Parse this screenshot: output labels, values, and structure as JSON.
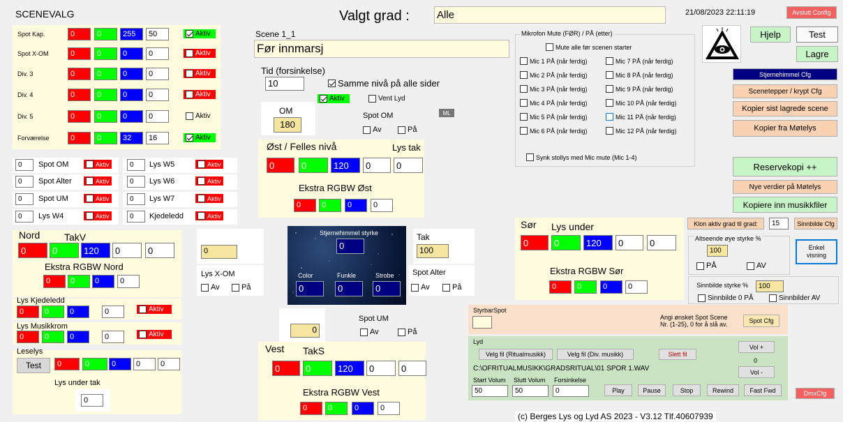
{
  "header": {
    "title": "SCENEVALG",
    "valgt_grad_label": "Valgt grad :",
    "valgt_grad_value": "Alle",
    "datetime": "21/08/2023 22:11:19",
    "exit_label": "Avslutt Config"
  },
  "rgb_rows": [
    {
      "name": "Spot Kap.",
      "r": "0",
      "g": "0",
      "b": "255",
      "w": "50",
      "active": "Aktiv",
      "on": true
    },
    {
      "name": "Spot X-OM",
      "r": "0",
      "g": "0",
      "b": "0",
      "w": "0",
      "active": "Aktiv",
      "on": false
    },
    {
      "name": "Div. 3",
      "r": "0",
      "g": "0",
      "b": "0",
      "w": "0",
      "active": "Aktiv",
      "on": false
    },
    {
      "name": "Div. 4",
      "r": "0",
      "g": "0",
      "b": "0",
      "w": "0",
      "active": "Aktiv",
      "on": false
    },
    {
      "name": "Div. 5",
      "r": "0",
      "g": "0",
      "b": "0",
      "w": "0",
      "active": "Aktiv",
      "on": false
    },
    {
      "name": "Forværelse",
      "r": "0",
      "g": "0",
      "b": "32",
      "w": "16",
      "active": "Aktiv",
      "on": true
    }
  ],
  "small_rows": {
    "left": [
      {
        "value": "0",
        "label": "Spot OM",
        "active": "Aktiv"
      },
      {
        "value": "0",
        "label": "Spot Alter",
        "active": "Aktiv"
      },
      {
        "value": "0",
        "label": "Spot UM",
        "active": "Aktiv"
      },
      {
        "value": "0",
        "label": "Lys W4",
        "active": "Aktiv"
      }
    ],
    "right": [
      {
        "value": "0",
        "label": "Lys W5",
        "active": "Aktiv"
      },
      {
        "value": "0",
        "label": "Lys W6",
        "active": "Aktiv"
      },
      {
        "value": "0",
        "label": "Lys W7",
        "active": "Aktiv"
      },
      {
        "value": "0",
        "label": "Kjedeledd",
        "active": "Aktiv"
      }
    ]
  },
  "nord": {
    "title": "Nord",
    "takv": "TakV",
    "r": "0",
    "g": "0",
    "b": "120",
    "w": "0",
    "extra": "0",
    "ekstra_title": "Ekstra RGBW Nord",
    "er": "0",
    "eg": "0",
    "eb": "0",
    "ew": "0"
  },
  "lys_kjedeledd": {
    "title": "Lys Kjedeledd",
    "r": "0",
    "g": "0",
    "b": "0",
    "w": "0",
    "active": "Aktiv"
  },
  "lys_musikkrom": {
    "title": "Lys Musikkrom",
    "r": "0",
    "g": "0",
    "b": "0",
    "w": "0",
    "active": "Aktiv"
  },
  "leselys": {
    "title": "Leselys",
    "test": "Test",
    "r": "0",
    "g": "0",
    "b": "0",
    "w": "0",
    "extra": "0",
    "under_tak_label": "Lys under tak",
    "under_tak_value": "0"
  },
  "scene": {
    "label": "Scene 1_1",
    "name": "Før innmarsj",
    "tid_label": "Tid (forsinkelse)",
    "tid_value": "10",
    "samme_niva": "Samme nivå på alle sider",
    "aktiv": "Aktiv",
    "vent_lyd": "Vent Lyd",
    "om_label": "OM",
    "om_value": "180",
    "spot_om_label": "Spot OM",
    "av": "Av",
    "pa": "På",
    "ml": "ML"
  },
  "ost": {
    "title": "Øst / Felles nivå",
    "lys_tak": "Lys tak",
    "r": "0",
    "g": "0",
    "b": "120",
    "w": "0",
    "tak": "0",
    "ekstra_title": "Ekstra RGBW Øst",
    "er": "0",
    "eg": "0",
    "eb": "0",
    "ew": "0"
  },
  "x_om": {
    "value": "0",
    "label": "Lys X-OM",
    "av": "Av",
    "pa": "På"
  },
  "stjernehimmel": {
    "styrke_label": "Stjernehimmel styrke",
    "styrke": "0",
    "color_label": "Color",
    "color": "0",
    "funkle_label": "Funkle",
    "funkle": "0",
    "strobe_label": "Strobe",
    "strobe": "0"
  },
  "tak": {
    "label": "Tak",
    "value": "100",
    "spot_alter": "Spot Alter",
    "av": "Av",
    "pa": "På"
  },
  "um": {
    "value": "0",
    "label": "Spot UM",
    "av": "Av",
    "pa": "På"
  },
  "vest": {
    "title": "Vest",
    "taks": "TakS",
    "r": "0",
    "g": "0",
    "b": "120",
    "w": "0",
    "extra": "0",
    "ekstra_title": "Ekstra RGBW Vest",
    "er": "0",
    "eg": "0",
    "eb": "0",
    "ew": "0"
  },
  "mic": {
    "group_label": "Mikrofon Mute (FØR) / PÅ (etter)",
    "mute_all": "Mute alle før scenen starter",
    "left": [
      "Mic 1 PÅ (når ferdig)",
      "Mic 2 PÅ (når ferdig)",
      "Mic 3 PÅ (når ferdig)",
      "Mic 4 PÅ (når ferdig)",
      "Mic 5 PÅ (når ferdig)",
      "Mic 6 PÅ (når ferdig)"
    ],
    "right": [
      "Mic 7 PÅ (når ferdig)",
      "Mic 8 PÅ (når ferdig)",
      "Mic 9 PÅ (når ferdig)",
      "Mic 10 PÅ (når ferdig)",
      "Mic 11 PÅ (når ferdig)",
      "Mic 12 PÅ (når ferdig)"
    ],
    "synk": "Synk stollys med Mic mute (Mic 1-4)"
  },
  "buttons": {
    "hjelp": "Hjelp",
    "test": "Test",
    "lagre": "Lagre",
    "stjernehimmel_cfg": "Stjernehimmel Cfg",
    "scenetepper": "Scenetepper / krypt Cfg",
    "kopier_sist": "Kopier sist lagrede scene",
    "kopier_motelys": "Kopier fra Møtelys",
    "reservekopi": "Reservekopi ++",
    "nye_verdier": "Nye verdier på Møtelys",
    "kopiere_musikk": "Kopiere inn musikkfiler",
    "sinnbilde_cfg": "Sinnbilde Cfg",
    "enkel_visning": "Enkel visning",
    "dmx_cfg": "DmxCfg"
  },
  "klon": {
    "label": "Klon aktiv grad til grad:",
    "value": "15"
  },
  "sor": {
    "title": "Sør",
    "lys_under": "Lys under",
    "r": "0",
    "g": "0",
    "b": "120",
    "w": "0",
    "under": "0",
    "ekstra_title": "Ekstra RGBW Sør",
    "er": "0",
    "eg": "0",
    "eb": "0",
    "ew": "0"
  },
  "alteende": {
    "label": "Altseende øye styrke %",
    "value": "100",
    "pa": "PÅ",
    "av": "AV"
  },
  "sinnbilde": {
    "label": "Sinnbilde styrke %",
    "value": "100",
    "s0": "Sinnbilde 0 PÅ",
    "sav": "Sinnbilder AV"
  },
  "styrbar": {
    "label": "StyrbarSpot",
    "hint1": "Angi ønsket Spot Scene",
    "hint2": "Nr. (1-25), 0 for å slå av.",
    "btn": "Spot Cfg",
    "value": ""
  },
  "lyd": {
    "label": "Lyd",
    "velg_ritual": "Velg fil (Ritualmusikk)",
    "velg_div": "Velg fil (Div. musikk)",
    "slett": "Slett fil",
    "vol_plus": "Vol +",
    "vol_value": "0",
    "vol_minus": "Vol -",
    "path": "C:\\OFRITUALMUSIKK\\GRADSRITUAL\\01 SPOR 1.WAV",
    "start_label": "Start Volum",
    "slutt_label": "Slutt Volum",
    "forsink_label": "Forsinkelse",
    "start": "50",
    "slutt": "50",
    "forsink": "0",
    "play": "Play",
    "pause": "Pause",
    "stop": "Stop",
    "rewind": "Rewind",
    "fastfwd": "Fast Fwd"
  },
  "footer": "(c) Berges Lys og Lyd AS 2023 - V3.12   Tlf.40607939",
  "colors": {
    "red": "#ff0000",
    "green": "#00ff00",
    "blue": "#0000ff",
    "panel": "#fffbde",
    "peach": "#f9d2b4",
    "sound_green": "#c9e3c3"
  }
}
